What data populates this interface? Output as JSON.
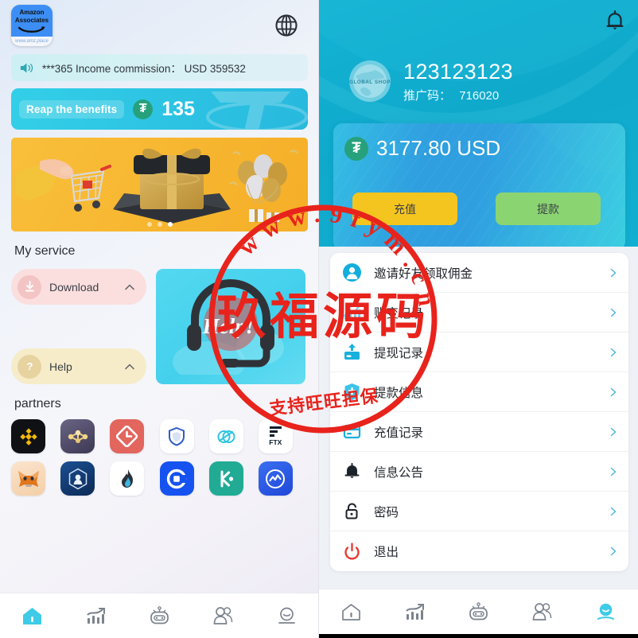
{
  "theme": {
    "cyan": "#0fa9cc",
    "accent_blue": "#2f9fe0",
    "yellow": "#f5c51f",
    "green": "#8bd472",
    "usdt_green": "#26a17b",
    "logout_red": "#e8352b"
  },
  "left_panel": {
    "logo": {
      "name": "amazon-associates-logo",
      "line1": "Amazon",
      "line2": "Associates",
      "url": "www.amz.place"
    },
    "language_icon": "globe-icon",
    "marquee": {
      "icon": "speaker-icon",
      "text": "***365 Income commission： USD 359532"
    },
    "benefits_banner": {
      "label": "Reap the benefits",
      "coin_icon": "usdt-coin-icon",
      "coin_symbol": "₮",
      "amount": "135"
    },
    "carousel": {
      "slides_total": 3,
      "active_slide": 3
    },
    "service": {
      "title": "My service",
      "items": [
        {
          "label": "Download",
          "icon": "download-circle-icon",
          "chevron": "chevron-up-icon"
        },
        {
          "label": "Help",
          "icon": "question-circle-icon",
          "chevron": "chevron-up-icon"
        }
      ],
      "help_card": {
        "icon": "headset-icon",
        "text": "Help!"
      }
    },
    "partners": {
      "title": "partners",
      "items": [
        {
          "name": "binance"
        },
        {
          "name": "tron"
        },
        {
          "name": "gate-io"
        },
        {
          "name": "safepal"
        },
        {
          "name": "sui"
        },
        {
          "name": "ftx",
          "label": "FTX"
        },
        {
          "name": "metamask"
        },
        {
          "name": "crypto-com"
        },
        {
          "name": "huobi"
        },
        {
          "name": "coinbase"
        },
        {
          "name": "kucoin"
        },
        {
          "name": "coinmarketcap"
        }
      ]
    },
    "tabbar": {
      "active_index": 0,
      "items": [
        {
          "name": "home",
          "icon": "home-icon"
        },
        {
          "name": "market",
          "icon": "chart-growth-icon"
        },
        {
          "name": "robot",
          "icon": "robot-icon"
        },
        {
          "name": "team",
          "icon": "users-icon"
        },
        {
          "name": "profile",
          "icon": "person-icon"
        }
      ]
    }
  },
  "right_panel": {
    "notification_icon": "bell-icon",
    "account": {
      "avatar_icon": "global-shop-logo",
      "avatar_text": "GLOBAL SHOP",
      "username": "123123123",
      "promo_label": "推广码：",
      "promo_code": "716020"
    },
    "balance_card": {
      "coin_icon": "usdt-coin-icon",
      "coin_symbol": "₮",
      "amount": "3177.80 USD",
      "recharge_label": "充值",
      "withdraw_label": "提款"
    },
    "menu": [
      {
        "label": "邀请好友领取佣金",
        "icon": "user-avatar-icon",
        "chevron": "chevron-right-icon"
      },
      {
        "label": "账变记录",
        "icon": "bar-chart-icon",
        "chevron": "chevron-right-icon"
      },
      {
        "label": "提现记录",
        "icon": "withdraw-card-icon",
        "chevron": "chevron-right-icon"
      },
      {
        "label": "提款信息",
        "icon": "shield-plus-icon",
        "chevron": "chevron-right-icon"
      },
      {
        "label": "充值记录",
        "icon": "credit-card-icon",
        "chevron": "chevron-right-icon"
      },
      {
        "label": "信息公告",
        "icon": "bell-filled-icon",
        "chevron": "chevron-right-icon"
      },
      {
        "label": "密码",
        "icon": "lock-icon",
        "chevron": "chevron-right-icon"
      },
      {
        "label": "退出",
        "icon": "power-icon",
        "chevron": "chevron-right-icon"
      }
    ],
    "tabbar": {
      "active_index": 4,
      "items": [
        {
          "name": "home",
          "icon": "home-icon"
        },
        {
          "name": "market",
          "icon": "chart-growth-icon"
        },
        {
          "name": "robot",
          "icon": "robot-icon"
        },
        {
          "name": "team",
          "icon": "users-icon"
        },
        {
          "name": "profile",
          "icon": "person-icon"
        }
      ]
    }
  },
  "watermark": {
    "center_text": "玖福源码",
    "ring_text": "www.9fym.cn",
    "sub_text": "支持旺旺担保",
    "color": "#e8231c"
  }
}
